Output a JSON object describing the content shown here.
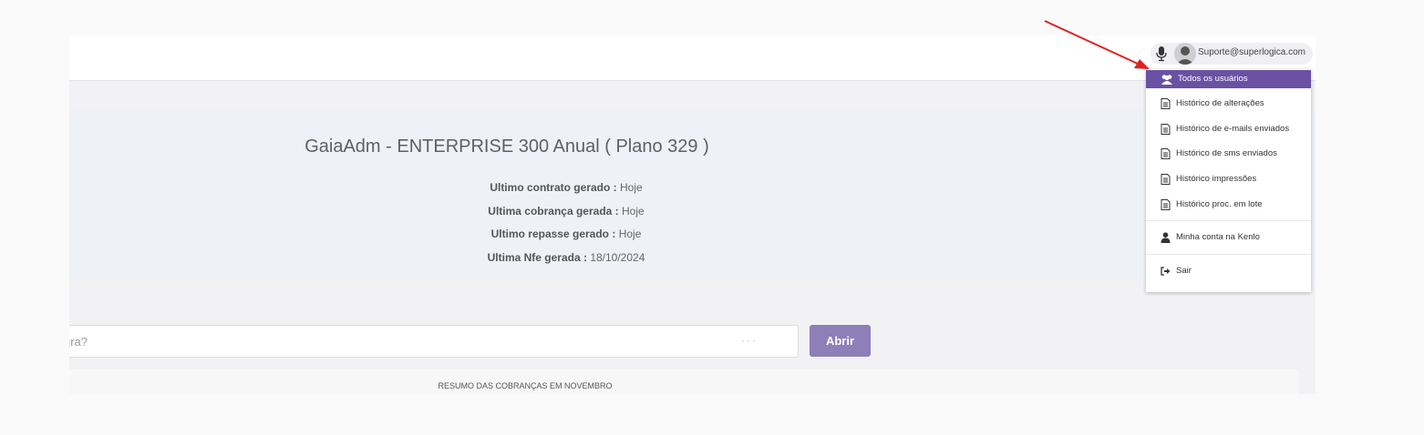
{
  "header": {
    "user_email": "Suporte@superlogica.com"
  },
  "user_menu": {
    "items": [
      {
        "label": "Todos os usuários",
        "icon": "users-icon",
        "active": true
      },
      {
        "label": "Histórico de alterações",
        "icon": "document-icon"
      },
      {
        "label": "Histórico de e-mails enviados",
        "icon": "document-icon"
      },
      {
        "label": "Histórico de sms enviados",
        "icon": "document-icon"
      },
      {
        "label": "Histórico impressões",
        "icon": "document-icon"
      },
      {
        "label": "Histórico proc. em lote",
        "icon": "document-icon"
      },
      {
        "label": "Minha conta na Kenlo",
        "icon": "user-icon"
      },
      {
        "label": "Sair",
        "icon": "sign-out-icon"
      }
    ]
  },
  "plan": {
    "title": "GaiaAdm - ENTERPRISE 300 Anual ( Plano 329 )",
    "lines": [
      {
        "label": "Ultimo contrato gerado :",
        "value": "Hoje"
      },
      {
        "label": "Ultima cobrança gerada :",
        "value": "Hoje"
      },
      {
        "label": "Ultimo repasse gerado :",
        "value": "Hoje"
      },
      {
        "label": "Ultima Nfe gerada :",
        "value": "18/10/2024"
      }
    ]
  },
  "search": {
    "visible_text": "ura?",
    "button_label": "Abrir"
  },
  "summary": {
    "title": "RESUMO DAS COBRANÇAS EM NOVEMBRO"
  },
  "colors": {
    "accent": "#6a51a3",
    "button": "#8f7fb8",
    "annotation_arrow": "#e02020"
  }
}
